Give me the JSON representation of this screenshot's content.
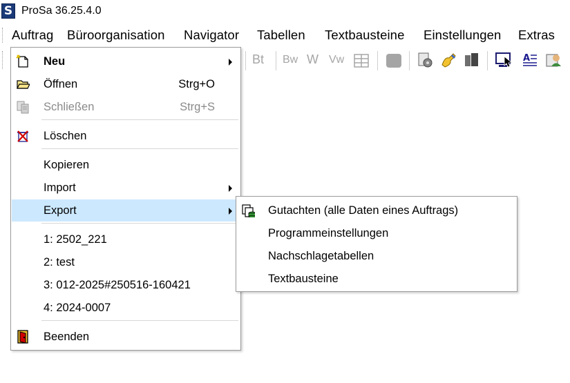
{
  "window": {
    "title": "ProSa 36.25.4.0",
    "icon_letter": "S"
  },
  "menubar": {
    "items": [
      {
        "label": "Auftrag"
      },
      {
        "label": "Büroorganisation"
      },
      {
        "label": "Navigator"
      },
      {
        "label": "Tabellen"
      },
      {
        "label": "Textbausteine"
      },
      {
        "label": "Einstellungen"
      },
      {
        "label": "Extras"
      }
    ]
  },
  "toolbar": {
    "buttons": [
      {
        "label": "Bt"
      },
      {
        "label": "Bw"
      },
      {
        "label": "W"
      },
      {
        "label": "Vw"
      }
    ]
  },
  "auftrag_menu": {
    "neu": {
      "label": "Neu"
    },
    "oeffnen": {
      "label": "Öffnen",
      "shortcut": "Strg+O"
    },
    "schliessen": {
      "label": "Schließen",
      "shortcut": "Strg+S"
    },
    "loeschen": {
      "label": "Löschen"
    },
    "kopieren": {
      "label": "Kopieren"
    },
    "import": {
      "label": "Import"
    },
    "export": {
      "label": "Export"
    },
    "recent": [
      {
        "label": "1: 2502_221"
      },
      {
        "label": "2: test"
      },
      {
        "label": "3: 012-2025#250516-160421"
      },
      {
        "label": "4: 2024-0007"
      }
    ],
    "beenden": {
      "label": "Beenden"
    }
  },
  "export_submenu": {
    "items": [
      {
        "label": "Gutachten (alle Daten eines Auftrags)"
      },
      {
        "label": "Programmeinstellungen"
      },
      {
        "label": "Nachschlagetabellen"
      },
      {
        "label": "Textbausteine"
      }
    ]
  }
}
